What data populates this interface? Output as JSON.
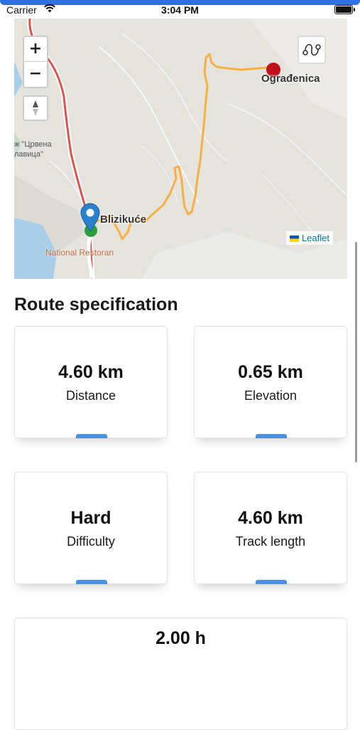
{
  "status_bar": {
    "carrier": "Carrier",
    "time": "3:04 PM"
  },
  "map": {
    "zoom_in_label": "+",
    "zoom_out_label": "−",
    "places": {
      "start": "Blizikuće",
      "end": "Ograđenica",
      "restaurant": "National Restoran",
      "cyr_line1": "ж \"Црвена",
      "cyr_line2": "лавица\""
    },
    "attribution": "Leaflet",
    "route_color": "#f5b041",
    "start_marker_color": "#2e9d3a",
    "end_marker_color": "#c0121d",
    "pin_color": "#2a81cb",
    "road_color": "#d9534f"
  },
  "section": {
    "title": "Route specification"
  },
  "cards": [
    {
      "value": "4.60 km",
      "label": "Distance"
    },
    {
      "value": "0.65 km",
      "label": "Elevation"
    },
    {
      "value": "Hard",
      "label": "Difficulty"
    },
    {
      "value": "4.60 km",
      "label": "Track length"
    },
    {
      "value": "2.00 h",
      "label": ""
    }
  ]
}
